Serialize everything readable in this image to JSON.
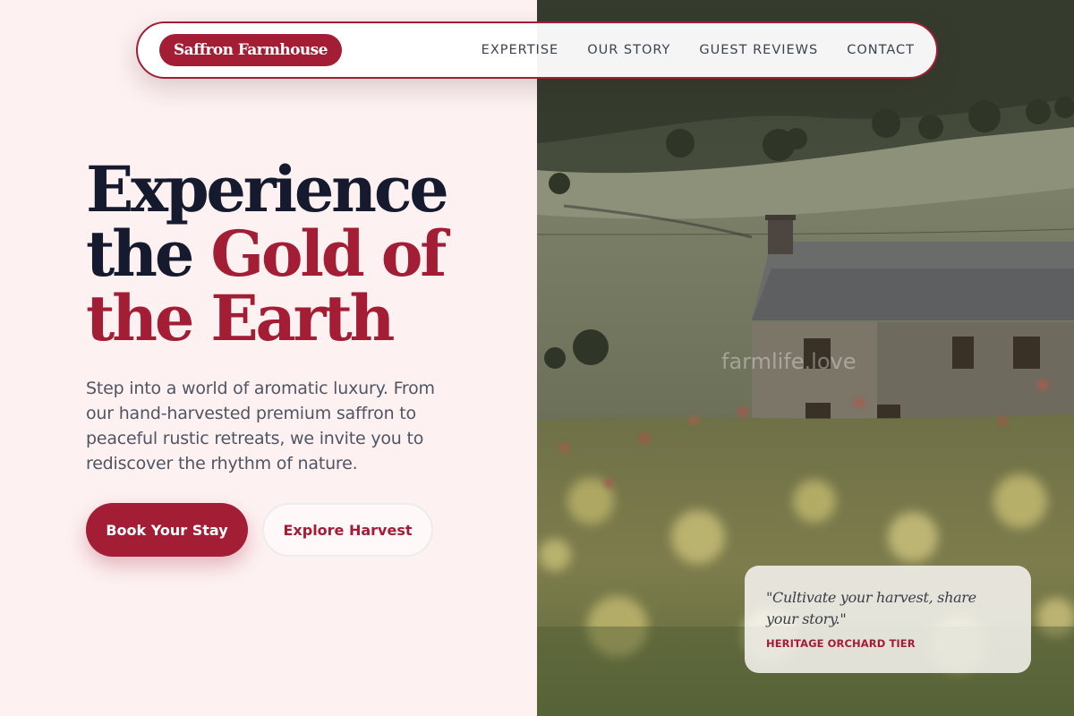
{
  "brand": {
    "name": "Saffron Farmhouse"
  },
  "nav": {
    "links": [
      "EXPERTISE",
      "OUR STORY",
      "GUEST REVIEWS",
      "CONTACT"
    ]
  },
  "hero": {
    "headline_line1": "Experience",
    "headline_line2_plain": "the ",
    "headline_line2_accent": "Gold of",
    "headline_line3_accent": "the Earth",
    "subtext": "Step into a world of aromatic luxury. From our hand-harvested premium saffron to peaceful rustic retreats, we invite you to rediscover the rhythm of nature.",
    "primary_button": "Book Your Stay",
    "secondary_button": "Explore Harvest"
  },
  "image": {
    "watermark": "farmlife.love"
  },
  "quote": {
    "text": "\"Cultivate your harvest, share your story.\"",
    "tier": "HERITAGE ORCHARD TIER"
  },
  "colors": {
    "accent": "#a31d35",
    "dark": "#151a2e",
    "background": "#fdf1f1",
    "body_text": "#4f5563"
  }
}
